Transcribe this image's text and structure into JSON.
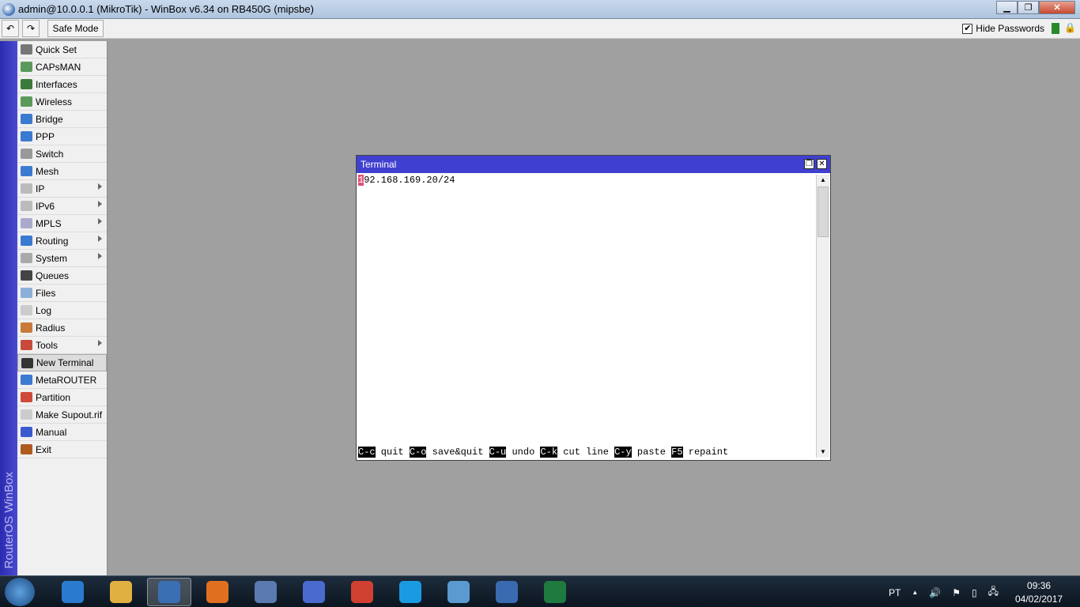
{
  "window": {
    "title": "admin@10.0.0.1 (MikroTik) - WinBox v6.34 on RB450G (mipsbe)",
    "minimize": "▁",
    "maximize": "❐",
    "close": "✕"
  },
  "toolbar": {
    "undo": "↶",
    "redo": "↷",
    "safe_mode": "Safe Mode",
    "hide_passwords": "Hide Passwords",
    "hide_passwords_checked": true,
    "check": "✔",
    "lock": "🔒"
  },
  "brand": "RouterOS WinBox",
  "menu": [
    {
      "label": "Quick Set",
      "color": "#777"
    },
    {
      "label": "CAPsMAN",
      "color": "#5a9a5a"
    },
    {
      "label": "Interfaces",
      "color": "#3a7a3a"
    },
    {
      "label": "Wireless",
      "color": "#5a9a5a"
    },
    {
      "label": "Bridge",
      "color": "#3a7ad0"
    },
    {
      "label": "PPP",
      "color": "#3a7ad0"
    },
    {
      "label": "Switch",
      "color": "#999"
    },
    {
      "label": "Mesh",
      "color": "#3a7ad0"
    },
    {
      "label": "IP",
      "color": "#bbb",
      "submenu": true
    },
    {
      "label": "IPv6",
      "color": "#bbb",
      "submenu": true
    },
    {
      "label": "MPLS",
      "color": "#aac",
      "submenu": true
    },
    {
      "label": "Routing",
      "color": "#3a7ad0",
      "submenu": true
    },
    {
      "label": "System",
      "color": "#aaa",
      "submenu": true
    },
    {
      "label": "Queues",
      "color": "#444"
    },
    {
      "label": "Files",
      "color": "#8ab0d8"
    },
    {
      "label": "Log",
      "color": "#ccc"
    },
    {
      "label": "Radius",
      "color": "#c87a3a"
    },
    {
      "label": "Tools",
      "color": "#c84a3a",
      "submenu": true
    },
    {
      "label": "New Terminal",
      "color": "#333",
      "selected": true
    },
    {
      "label": "MetaROUTER",
      "color": "#3a7ad0"
    },
    {
      "label": "Partition",
      "color": "#d04a3a"
    },
    {
      "label": "Make Supout.rif",
      "color": "#ccc"
    },
    {
      "label": "Manual",
      "color": "#3a5ad0"
    },
    {
      "label": "Exit",
      "color": "#b05a20"
    }
  ],
  "terminal": {
    "title": "Terminal",
    "restore": "❐",
    "close": "✕",
    "cursor_char": "1",
    "line_rest": "92.168.169.20/24",
    "keys": [
      {
        "key": "C-c",
        "label": " quit "
      },
      {
        "key": "C-o",
        "label": " save&quit "
      },
      {
        "key": "C-u",
        "label": " undo "
      },
      {
        "key": "C-k",
        "label": " cut line "
      },
      {
        "key": "C-y",
        "label": " paste "
      },
      {
        "key": "F5",
        "label": " repaint"
      }
    ],
    "scroll_up": "▲",
    "scroll_down": "▼"
  },
  "taskbar": {
    "apps": [
      {
        "name": "internet-explorer",
        "color": "#2a7ad0"
      },
      {
        "name": "file-explorer",
        "color": "#e0b040"
      },
      {
        "name": "winbox",
        "color": "#3a6fb3",
        "active": true
      },
      {
        "name": "media-player",
        "color": "#e07020"
      },
      {
        "name": "thunderbird",
        "color": "#5a7ab0"
      },
      {
        "name": "network-tool",
        "color": "#4a6ad0"
      },
      {
        "name": "chrome",
        "color": "#d04030"
      },
      {
        "name": "skype",
        "color": "#1a9ae0"
      },
      {
        "name": "remote-desktop",
        "color": "#5a9ad0"
      },
      {
        "name": "google-earth",
        "color": "#3a6ab0"
      },
      {
        "name": "excel",
        "color": "#1e7a3e"
      }
    ],
    "lang": "PT",
    "tray_up": "▲",
    "volume": "🔊",
    "flag": "⚑",
    "battery": "▯",
    "network": "🖧",
    "time": "09:36",
    "date": "04/02/2017"
  }
}
